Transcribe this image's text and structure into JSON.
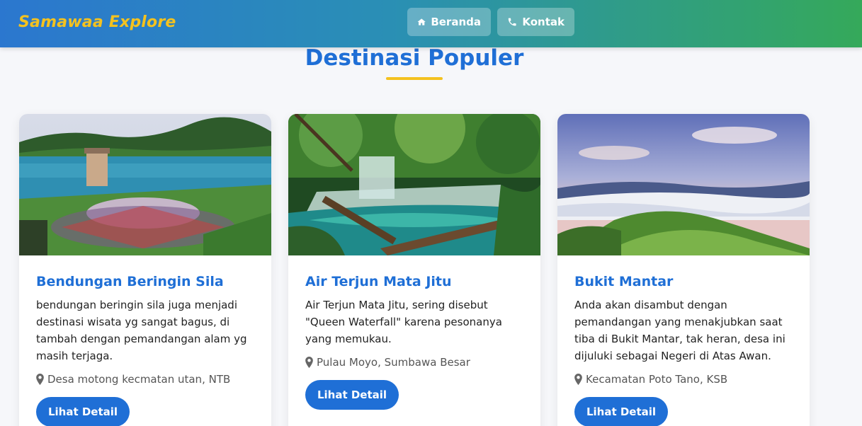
{
  "navbar": {
    "brand": "Samawaa Explore",
    "items": [
      {
        "label": "Beranda",
        "icon": "home-icon"
      },
      {
        "label": "Kontak",
        "icon": "phone-icon"
      }
    ]
  },
  "section": {
    "title": "Destinasi Populer"
  },
  "cards": [
    {
      "title": "Bendungan Beringin Sila",
      "description": "bendungan beringin sila juga menjadi destinasi wisata yg sangat bagus, di tambah dengan pemandangan alam yg masih terjaga.",
      "location": "Desa motong kecmatan utan, NTB",
      "button": "Lihat Detail"
    },
    {
      "title": "Air Terjun Mata Jitu",
      "description": "Air Terjun Mata Jitu, sering disebut \"Queen Waterfall\" karena pesonanya yang memukau.",
      "location": "Pulau Moyo, Sumbawa Besar",
      "button": "Lihat Detail"
    },
    {
      "title": "Bukit Mantar",
      "description": "Anda akan disambut dengan pemandangan yang menakjubkan saat tiba di Bukit Mantar, tak heran, desa ini dijuluki sebagai Negeri di Atas Awan.",
      "location": "Kecamatan Poto Tano, KSB",
      "button": "Lihat Detail"
    }
  ],
  "colors": {
    "brand": "#f4c21f",
    "accent": "#1f6fd6",
    "nav_gradient_start": "#2b77cf",
    "nav_gradient_end": "#35a95a"
  }
}
